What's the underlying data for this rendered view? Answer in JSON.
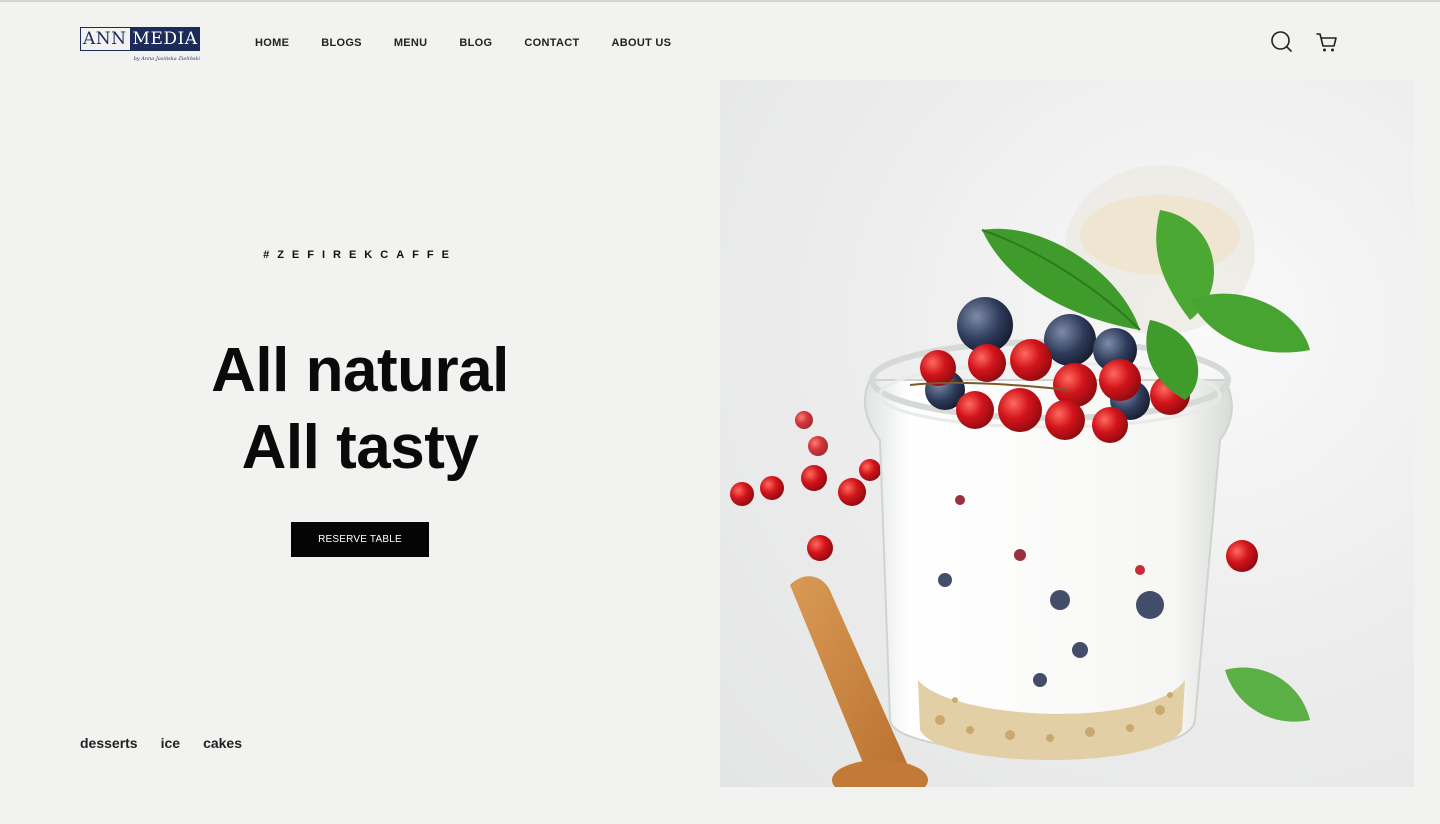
{
  "header": {
    "logo": {
      "part1": "ANN",
      "part2": "MEDIA",
      "tagline": "by Anna Jasińska Zieliński"
    },
    "nav": [
      "HOME",
      "BLOGS",
      "MENU",
      "BLOG",
      "CONTACT",
      "ABOUT US"
    ],
    "icons": [
      "search-icon",
      "cart-icon"
    ]
  },
  "hero": {
    "hashtag": "#ZEFIREKCAFFE",
    "headline_line1": "All natural",
    "headline_line2": "All tasty",
    "cta_label": "RESERVE TABLE",
    "tags": [
      "desserts",
      "ice",
      "cakes"
    ]
  },
  "image": {
    "subject": "yogurt parfait jar with blueberries, red currants and mint leaves, wooden spoon",
    "colors": {
      "berry_red": "#d2141b",
      "blueberry": "#2f3b5a",
      "mint": "#3f9c2c",
      "spoon": "#c9833f",
      "yogurt": "#f7f7f5"
    }
  }
}
